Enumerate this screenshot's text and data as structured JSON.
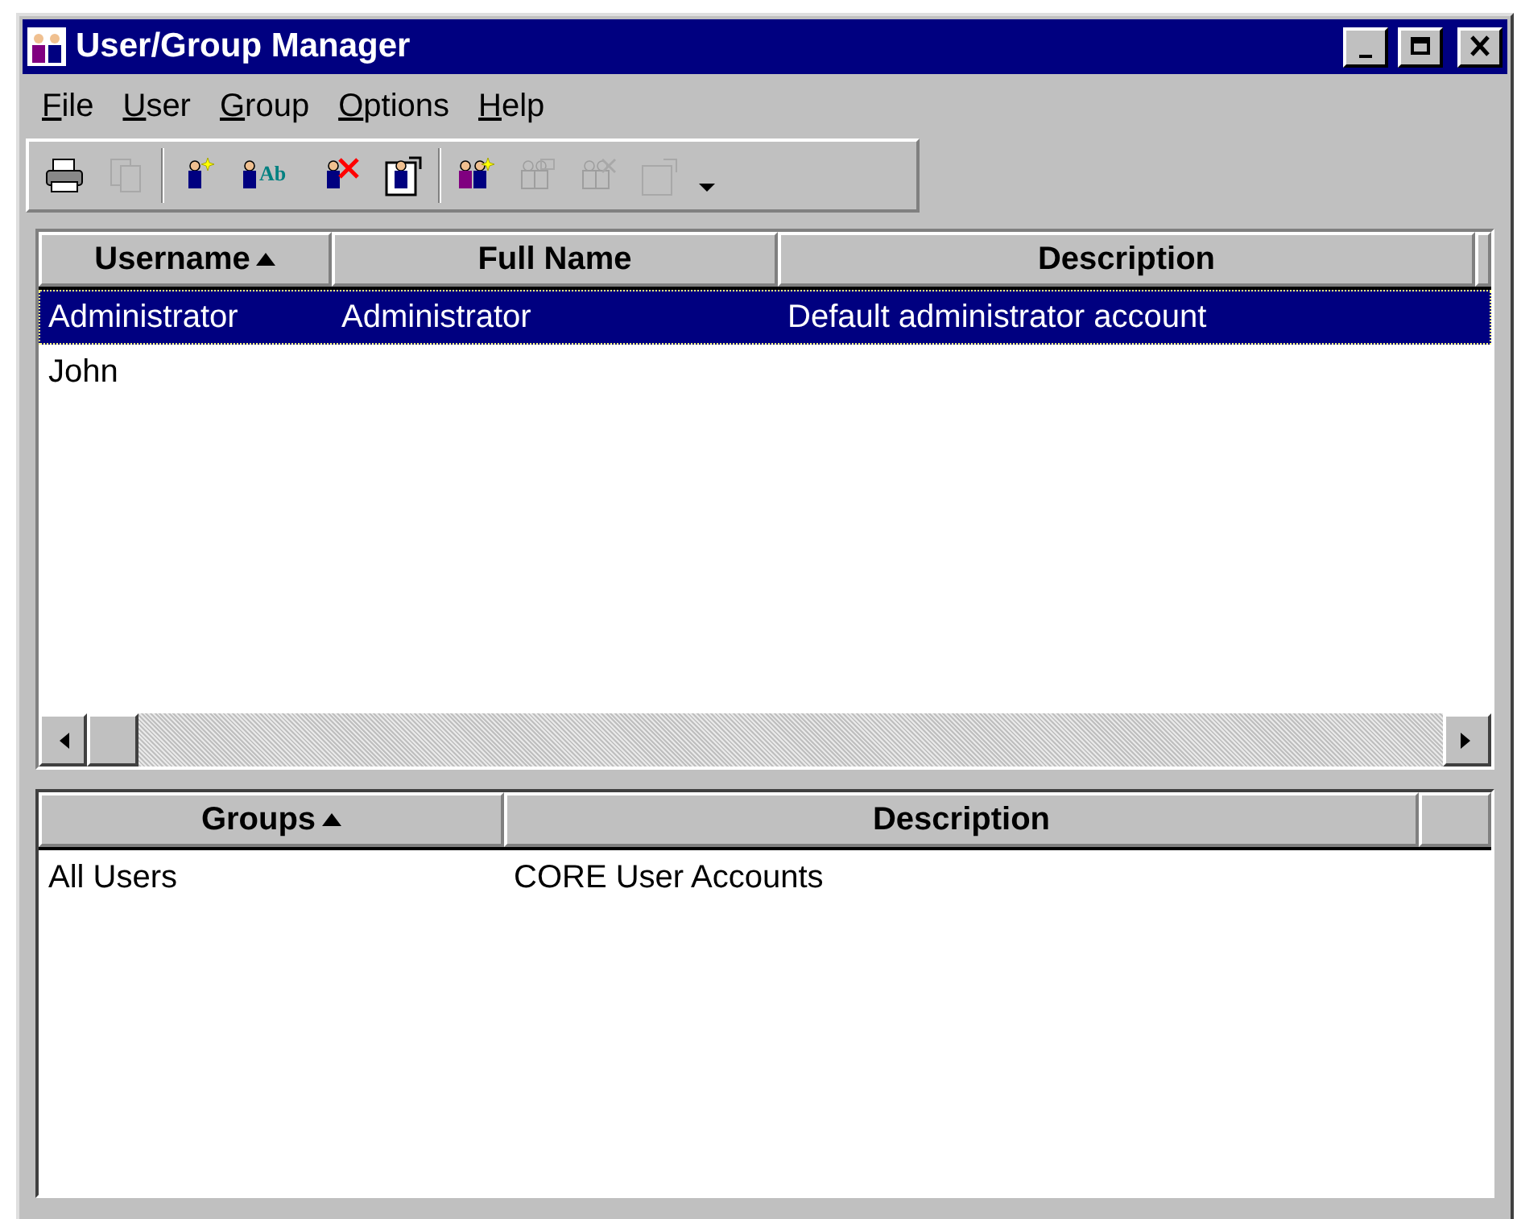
{
  "window": {
    "title": "User/Group Manager"
  },
  "menu": [
    {
      "label": "File"
    },
    {
      "label": "User"
    },
    {
      "label": "Group"
    },
    {
      "label": "Options"
    },
    {
      "label": "Help"
    }
  ],
  "toolbar": [
    {
      "kind": "print",
      "disabled": false
    },
    {
      "kind": "copy",
      "disabled": true
    },
    {
      "kind": "sep"
    },
    {
      "kind": "new-user",
      "disabled": false
    },
    {
      "kind": "rename-user",
      "disabled": false,
      "label": "Ab"
    },
    {
      "kind": "delete-user",
      "disabled": false
    },
    {
      "kind": "properties",
      "disabled": false
    },
    {
      "kind": "sep"
    },
    {
      "kind": "new-group",
      "disabled": false
    },
    {
      "kind": "rename-group",
      "disabled": true
    },
    {
      "kind": "delete-group",
      "disabled": true
    },
    {
      "kind": "group-properties",
      "disabled": true
    },
    {
      "kind": "dropdown",
      "disabled": false
    }
  ],
  "users_table": {
    "columns": [
      {
        "label": "Username",
        "sorted": true
      },
      {
        "label": "Full Name",
        "sorted": false
      },
      {
        "label": "Description",
        "sorted": false
      }
    ],
    "rows": [
      {
        "cells": [
          "Administrator",
          "Administrator",
          "Default administrator account"
        ],
        "selected": true
      },
      {
        "cells": [
          "John"
        ],
        "selected": false
      }
    ]
  },
  "groups_table": {
    "columns": [
      {
        "label": "Groups",
        "sorted": true
      },
      {
        "label": "Description",
        "sorted": false
      }
    ],
    "rows": [
      {
        "cells": [
          "All Users",
          "CORE User Accounts"
        ],
        "selected": false
      }
    ]
  }
}
